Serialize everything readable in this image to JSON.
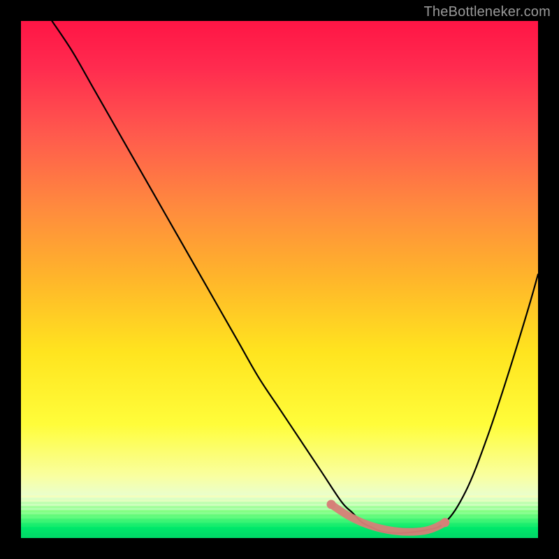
{
  "watermark": "TheBottleneker.com",
  "chart_data": {
    "type": "line",
    "title": "",
    "xlabel": "",
    "ylabel": "",
    "xlim": [
      0,
      100
    ],
    "ylim": [
      0,
      100
    ],
    "grid": false,
    "series": [
      {
        "name": "bottleneck-curve",
        "color": "#000000",
        "x": [
          6,
          10,
          14,
          18,
          22,
          26,
          30,
          34,
          38,
          42,
          46,
          50,
          54,
          58,
          62,
          64,
          66,
          68,
          70,
          72,
          74,
          78,
          82,
          86,
          90,
          94,
          98,
          100
        ],
        "y": [
          100,
          94,
          87,
          80,
          73,
          66,
          59,
          52,
          45,
          38,
          31,
          25,
          19,
          13,
          7,
          5,
          3,
          2,
          1.2,
          1,
          1,
          1.5,
          3,
          9,
          19,
          31,
          44,
          51
        ]
      },
      {
        "name": "optimal-range-highlight",
        "color": "#d68078",
        "x": [
          60,
          63,
          66,
          69,
          72,
          75,
          78,
          80,
          82
        ],
        "y": [
          6.5,
          4.5,
          3,
          2,
          1.4,
          1.2,
          1.4,
          2,
          3
        ]
      }
    ],
    "annotations": [],
    "background_gradient": {
      "top": "#ff1545",
      "mid": "#ffe41f",
      "bottom": "#00d867"
    }
  }
}
